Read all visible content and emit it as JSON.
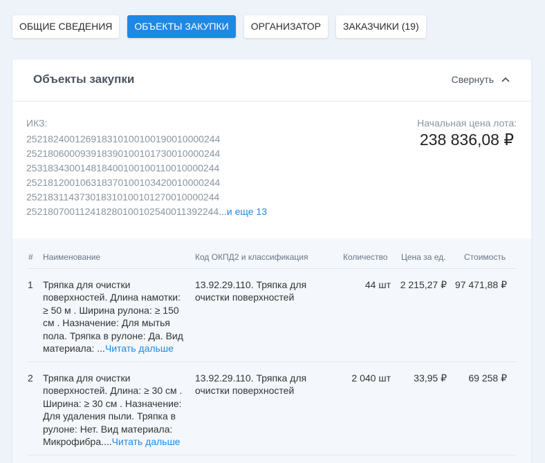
{
  "tabs": [
    {
      "label": "Общие сведения"
    },
    {
      "label": "Объекты закупки"
    },
    {
      "label": "Организатор"
    },
    {
      "label": "Заказчики (19)"
    }
  ],
  "section": {
    "title": "Объекты закупки",
    "collapse_label": "Свернуть"
  },
  "ikz": {
    "label": "ИКЗ:",
    "codes": [
      "252182400126918310100100190010000244",
      "252180600093918390100101730010000244",
      "253183430014818400100100110010000244",
      "252181200106318370100103420010000244",
      "252183114373018310100101270010000244",
      "252180700112418280100102540011392244"
    ],
    "more_link": "...и еще 13"
  },
  "price": {
    "label": "Начальная цена лота:",
    "value": "238 836,08 ₽"
  },
  "table": {
    "headers": {
      "num": "#",
      "name": "Наименование",
      "okpd": "Код ОКПД2 и классификация",
      "qty": "Количество",
      "unit_price": "Цена за ед.",
      "cost": "Стоимость"
    },
    "rows": [
      {
        "num": "1",
        "name_lines": [
          "Тряпка для очистки",
          "поверхностей. Длина намотки:",
          "≥ 50 м . Ширина рулона: ≥ 150",
          "см . Назначение: Для мытья",
          "пола. Тряпка в рулоне: Да. Вид"
        ],
        "name_last": "материала: ...",
        "read_more": "Читать дальше",
        "okpd_lines": [
          "13.92.29.110. Тряпка для",
          "очистки поверхностей"
        ],
        "qty": "44 шт",
        "unit_price": "2 215,27 ₽",
        "cost": "97 471,88 ₽"
      },
      {
        "num": "2",
        "name_lines": [
          "Тряпка для очистки",
          "поверхностей. Длина: ≥ 30 см .",
          "Ширина: ≥ 30 см . Назначение:",
          "Для удаления пыли. Тряпка в",
          "рулоне: Нет. Вид материала:"
        ],
        "name_last": "Микрофибра....",
        "read_more": "Читать дальше",
        "okpd_lines": [
          "13.92.29.110. Тряпка для",
          "очистки поверхностей"
        ],
        "qty": "2 040 шт",
        "unit_price": "33,95 ₽",
        "cost": "69 258 ₽"
      }
    ]
  }
}
